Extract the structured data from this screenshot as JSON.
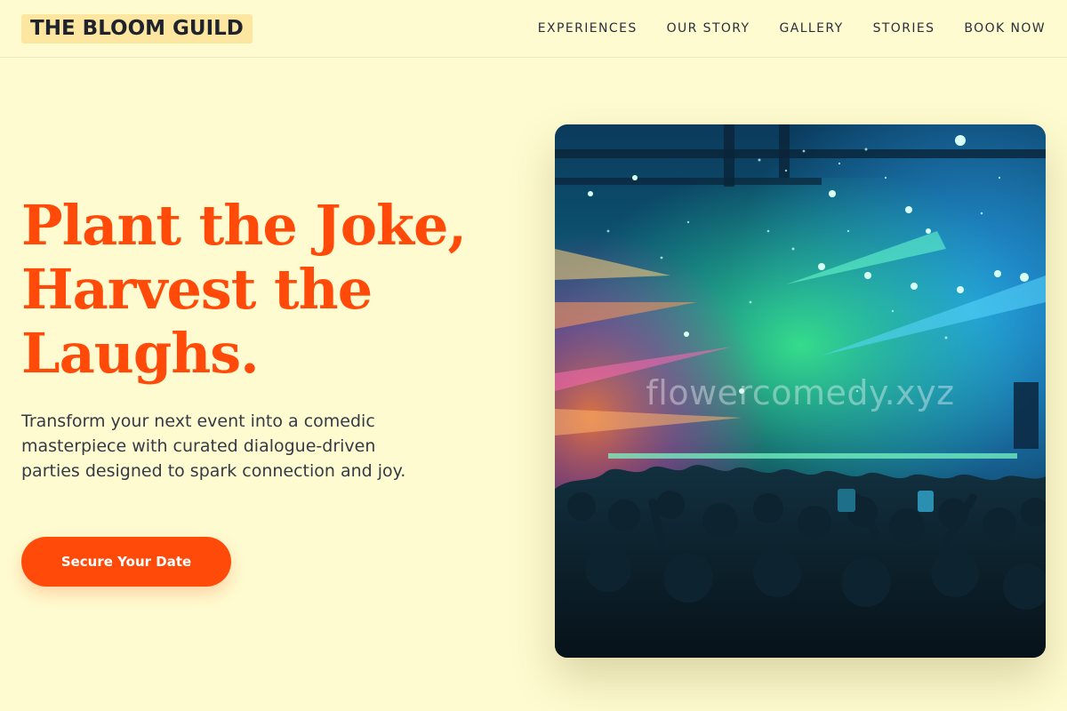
{
  "header": {
    "logo": "THE BLOOM GUILD",
    "nav": [
      {
        "label": "EXPERIENCES"
      },
      {
        "label": "OUR STORY"
      },
      {
        "label": "GALLERY"
      },
      {
        "label": "STORIES"
      },
      {
        "label": "BOOK NOW"
      }
    ]
  },
  "hero": {
    "headline_lines": [
      "Plant the Joke,",
      "Harvest the",
      "Laughs."
    ],
    "subtext": "Transform your next event into a comedic masterpiece with curated dialogue-driven parties designed to spark connection and joy.",
    "cta_label": "Secure Your Date",
    "image": {
      "watermark": "flowercomedy.xyz"
    }
  },
  "colors": {
    "background": "#fefbd0",
    "accent": "#ff4a0a",
    "logo_bg": "#fde7a0",
    "text": "#2b2f3a"
  }
}
